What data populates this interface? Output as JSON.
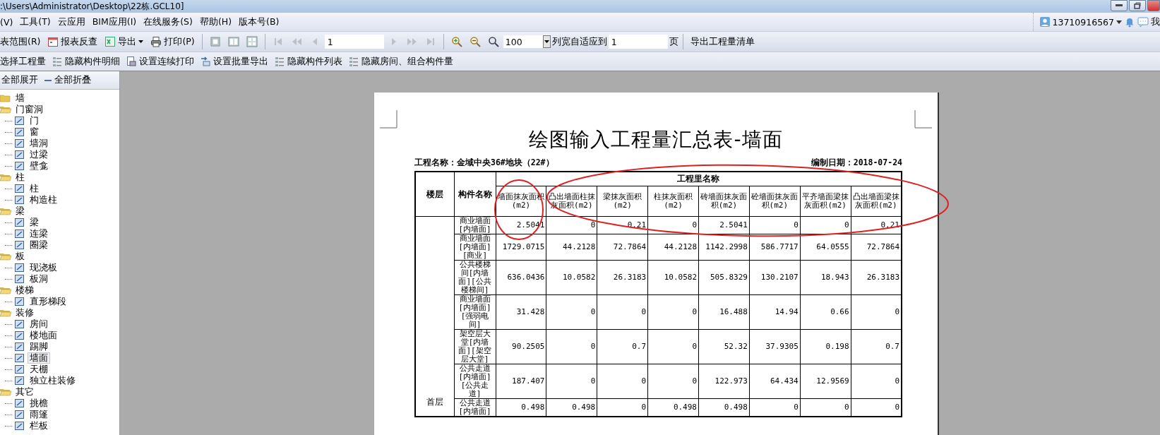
{
  "window": {
    "title": ":\\Users\\Administrator\\Desktop\\22栋.GCL10]"
  },
  "menu": [
    "(V)",
    "工具(T)",
    "云应用",
    "BIM应用(I)",
    "在线服务(S)",
    "帮助(H)",
    "版本号(B)"
  ],
  "user": {
    "account": "13710916567",
    "label": "我"
  },
  "toolbar": [
    {
      "kind": "button",
      "label": "表范围(R)"
    },
    {
      "kind": "button",
      "label": "报表反查"
    },
    {
      "kind": "menu-button",
      "label": "导出"
    },
    {
      "kind": "button",
      "label": "打印(P)"
    },
    {
      "kind": "separator"
    },
    {
      "kind": "icon-button",
      "disabled": false
    },
    {
      "kind": "icon-button",
      "disabled": false
    },
    {
      "kind": "icon-button",
      "disabled": false
    },
    {
      "kind": "separator"
    },
    {
      "kind": "icon-button",
      "disabled": true
    },
    {
      "kind": "icon-button",
      "disabled": true
    },
    {
      "kind": "icon-button",
      "disabled": true
    },
    {
      "kind": "field",
      "value": "1"
    },
    {
      "kind": "icon-button",
      "disabled": true
    },
    {
      "kind": "icon-button",
      "disabled": true
    },
    {
      "kind": "icon-button",
      "disabled": true
    },
    {
      "kind": "separator"
    },
    {
      "kind": "icon-button",
      "disabled": false
    },
    {
      "kind": "icon-button",
      "disabled": false
    },
    {
      "kind": "icon-button",
      "disabled": false
    },
    {
      "kind": "combo",
      "value": "100"
    },
    {
      "kind": "label",
      "label": "列宽自适应到"
    },
    {
      "kind": "field",
      "value": "1"
    },
    {
      "kind": "label",
      "label": "页"
    },
    {
      "kind": "separator"
    },
    {
      "kind": "button",
      "label": "导出工程量清单"
    }
  ],
  "toolbar2": [
    "选择工程量",
    "隐藏构件明细",
    "设置连续打印",
    "设置批量导出",
    "隐藏构件列表",
    "隐藏房间、组合构件量"
  ],
  "tree": {
    "expand_all": "全部展开",
    "collapse_all": "全部折叠",
    "items": [
      {
        "label": "墙",
        "expanded": false
      },
      {
        "label": "门窗洞",
        "expanded": true,
        "children": [
          {
            "label": "门",
            "selected": false
          },
          {
            "label": "窗",
            "selected": false
          },
          {
            "label": "墙洞",
            "selected": false
          },
          {
            "label": "过梁",
            "selected": false
          },
          {
            "label": "壁龛",
            "selected": false
          }
        ]
      },
      {
        "label": "柱",
        "expanded": true,
        "children": [
          {
            "label": "柱",
            "selected": false
          },
          {
            "label": "构造柱",
            "selected": false
          }
        ]
      },
      {
        "label": "梁",
        "expanded": true,
        "children": [
          {
            "label": "梁",
            "selected": false
          },
          {
            "label": "连梁",
            "selected": false
          },
          {
            "label": "圈梁",
            "selected": false
          }
        ]
      },
      {
        "label": "板",
        "expanded": true,
        "children": [
          {
            "label": "现浇板",
            "selected": false
          },
          {
            "label": "板洞",
            "selected": false
          }
        ]
      },
      {
        "label": "楼梯",
        "expanded": true,
        "children": [
          {
            "label": "直形梯段",
            "selected": false
          }
        ]
      },
      {
        "label": "装修",
        "expanded": true,
        "children": [
          {
            "label": "房间",
            "selected": false
          },
          {
            "label": "楼地面",
            "selected": false
          },
          {
            "label": "踢脚",
            "selected": false
          },
          {
            "label": "墙面",
            "selected": true
          },
          {
            "label": "天棚",
            "selected": false
          },
          {
            "label": "独立柱装修",
            "selected": false
          }
        ]
      },
      {
        "label": "其它",
        "expanded": true,
        "children": [
          {
            "label": "挑檐",
            "selected": false
          },
          {
            "label": "雨篷",
            "selected": false
          },
          {
            "label": "栏板",
            "selected": false
          }
        ]
      }
    ]
  },
  "report": {
    "title": "绘图输入工程量汇总表-墙面",
    "project": "工程名称：金域中央36#地块（22#）",
    "date": "编制日期：2018-07-24",
    "columns": [
      "楼层",
      "构件名称"
    ],
    "group": "工程里名称",
    "subcolumns": [
      "墙面抹灰面积(m2)",
      "凸出墙面柱抹灰面积(m2)",
      "梁抹灰面积(m2)",
      "柱抹灰面积(m2)",
      "砖墙面抹灰面积(m2)",
      "砼墙面抹灰面积(m2)",
      "平齐墙面梁抹灰面积(m2)",
      "凸出墙面梁抹灰面积(m2)"
    ],
    "floor": "首层",
    "rows": [
      {
        "name": "商业墙面[内墙面]",
        "values": [
          "2.5041",
          "0",
          "0.21",
          "0",
          "2.5041",
          "0",
          "0",
          "0.21"
        ]
      },
      {
        "name": "商业墙面[内墙面][商业]",
        "values": [
          "1729.0715",
          "44.2128",
          "72.7864",
          "44.2128",
          "1142.2998",
          "586.7717",
          "64.0555",
          "72.7864"
        ]
      },
      {
        "name": "公共楼梯间[内墙面][公共楼梯间]",
        "values": [
          "636.0436",
          "10.0582",
          "26.3183",
          "10.0582",
          "505.8329",
          "130.2107",
          "18.943",
          "26.3183"
        ]
      },
      {
        "name": "商业墙面[内墙面][强弱电间]",
        "values": [
          "31.428",
          "0",
          "0",
          "0",
          "16.488",
          "14.94",
          "0.66",
          "0"
        ]
      },
      {
        "name": "架空层大堂[内墙面][架空层大堂]",
        "values": [
          "90.2505",
          "0",
          "0.7",
          "0",
          "52.32",
          "37.9305",
          "0.198",
          "0.7"
        ]
      },
      {
        "name": "公共走道[内墙面][公共走道]",
        "values": [
          "187.407",
          "0",
          "0",
          "0",
          "122.973",
          "64.434",
          "12.9569",
          "0"
        ]
      },
      {
        "name": "公共走道[内墙面]",
        "values": [
          "0.498",
          "0.498",
          "0",
          "0.498",
          "0.498",
          "0",
          "0",
          "0"
        ]
      }
    ]
  }
}
